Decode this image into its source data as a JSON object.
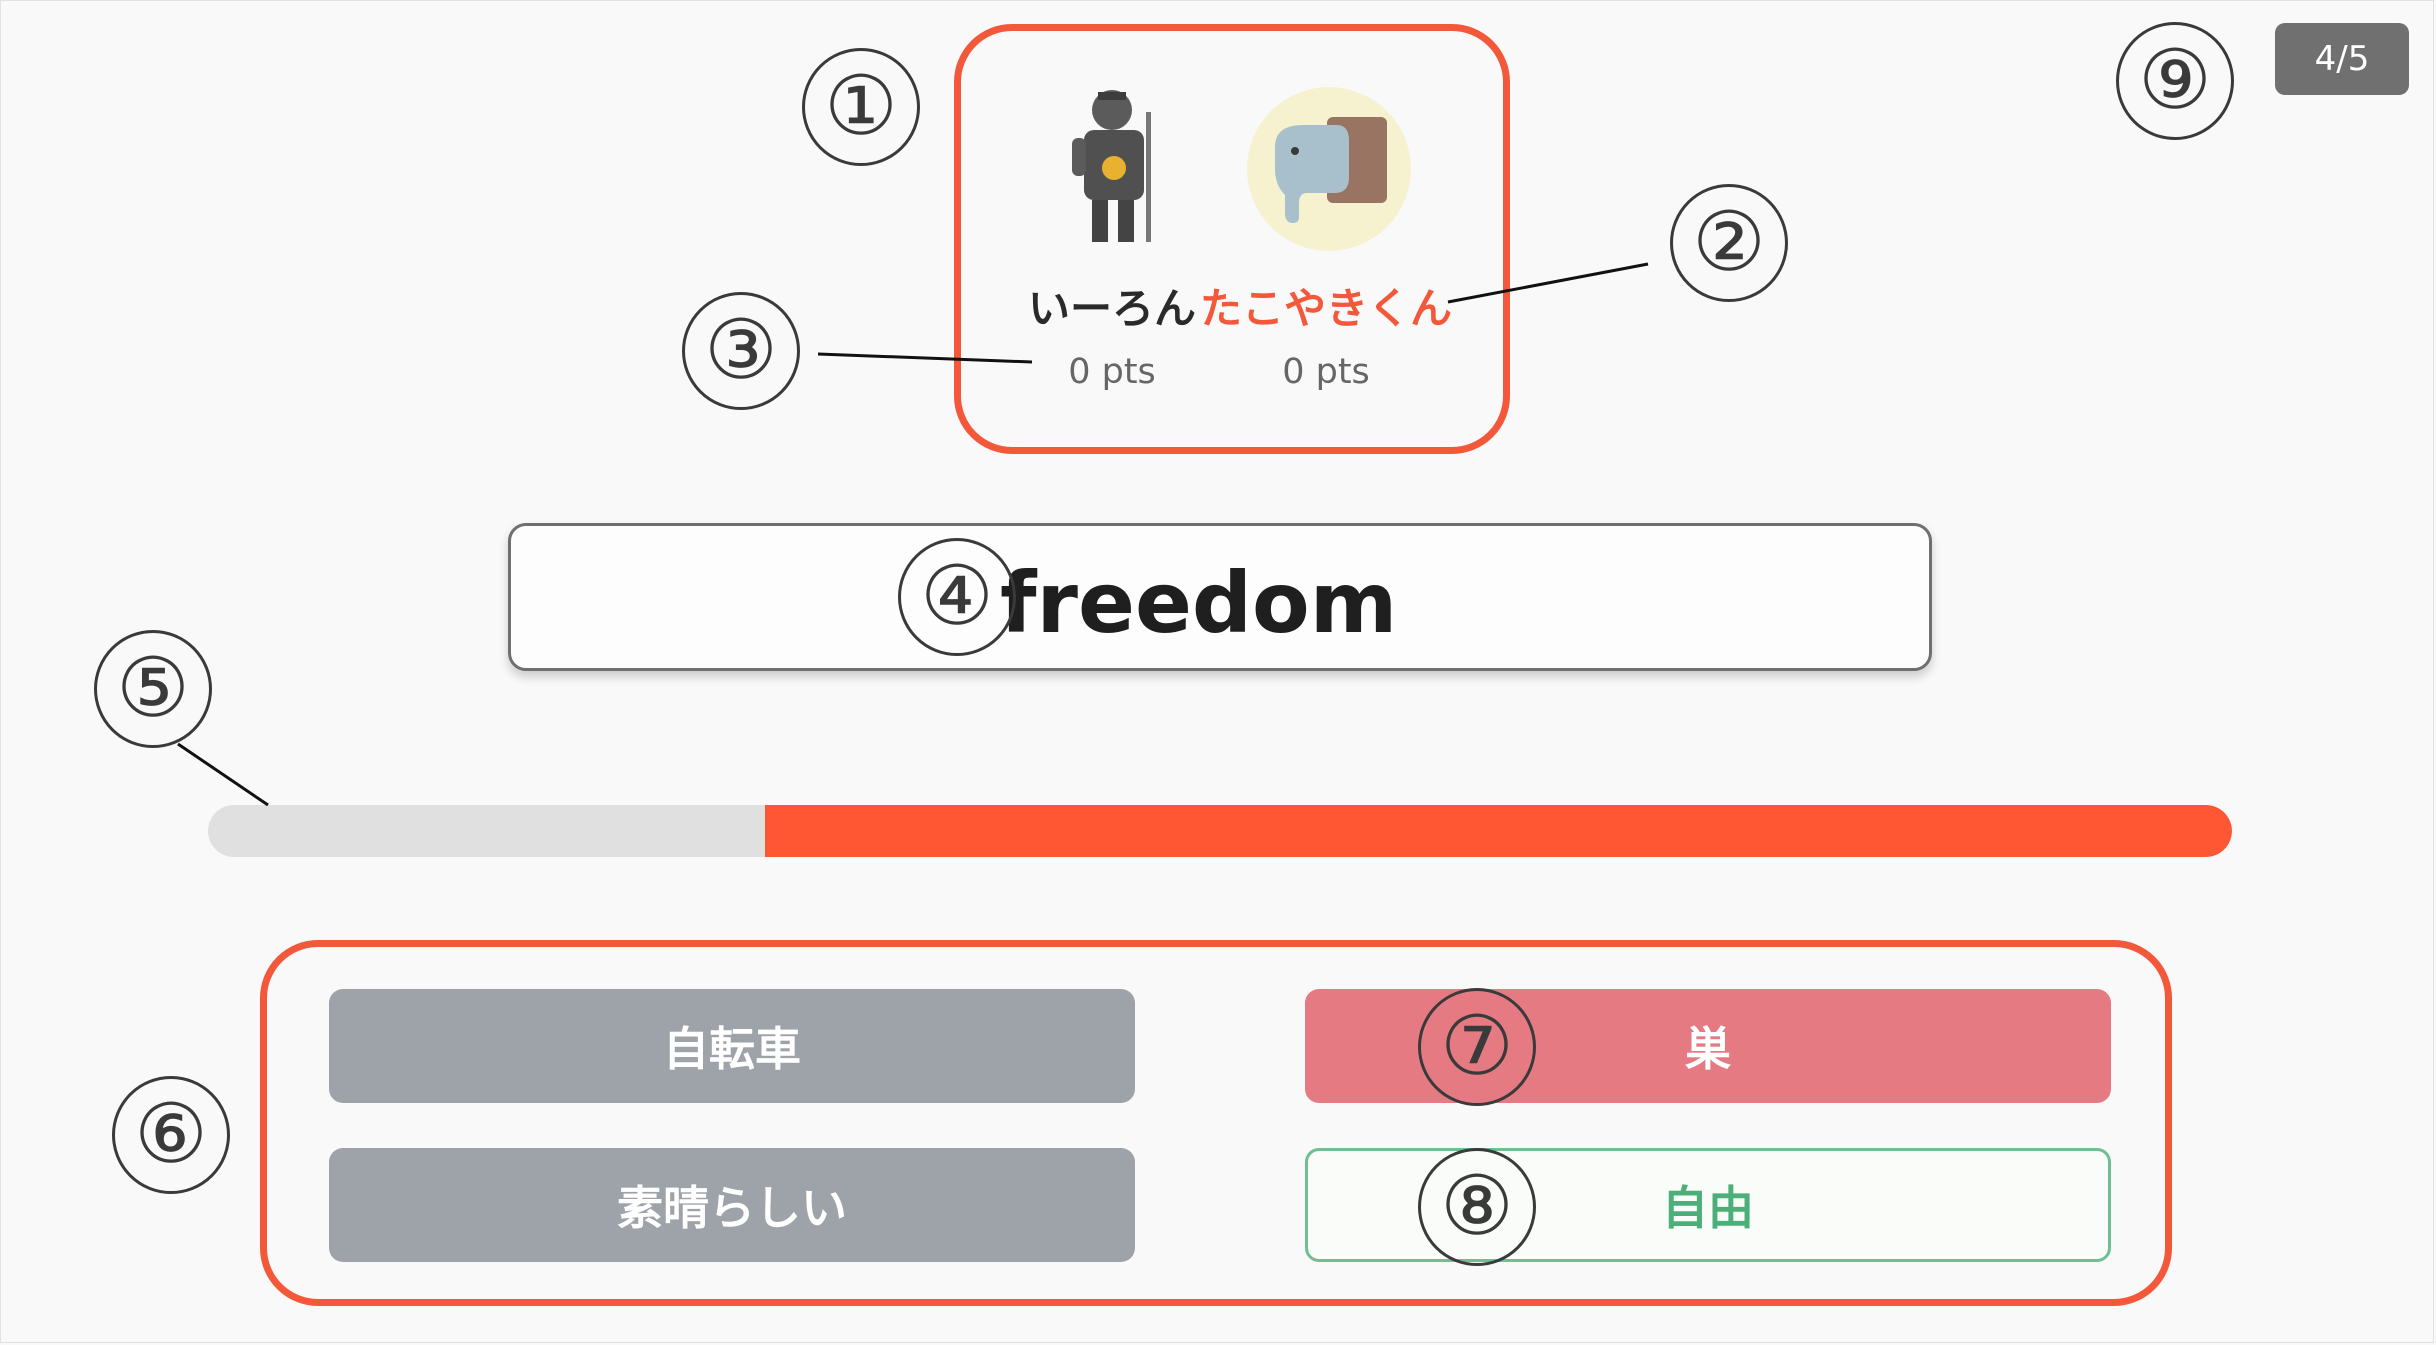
{
  "players": [
    {
      "name": "いーろん",
      "score": "0 pts",
      "active": false
    },
    {
      "name": "たこやきくん",
      "score": "0 pts",
      "active": true
    }
  ],
  "question": {
    "word": "freedom"
  },
  "timer": {
    "remaining_fraction": 0.725,
    "fill_color": "#ff5733",
    "track_color": "#e0e0e0"
  },
  "choices": [
    {
      "label": "自転車",
      "state": "neutral"
    },
    {
      "label": "巣",
      "state": "wrong"
    },
    {
      "label": "素晴らしい",
      "state": "neutral"
    },
    {
      "label": "自由",
      "state": "correct"
    }
  ],
  "page_counter": "4/5",
  "annotations": {
    "marker_1": "①",
    "marker_2": "②",
    "marker_3": "③",
    "marker_4": "④",
    "marker_5": "⑤",
    "marker_6": "⑥",
    "marker_7": "⑦",
    "marker_8": "⑧",
    "marker_9": "⑨"
  },
  "colors": {
    "accent": "#f4583a",
    "wrong": "#e57a83",
    "correct": "#4caf7a",
    "neutral": "#9ea3aa"
  },
  "icons": {
    "player_1_avatar": "samurai-icon",
    "player_2_avatar": "elephant-icon"
  }
}
